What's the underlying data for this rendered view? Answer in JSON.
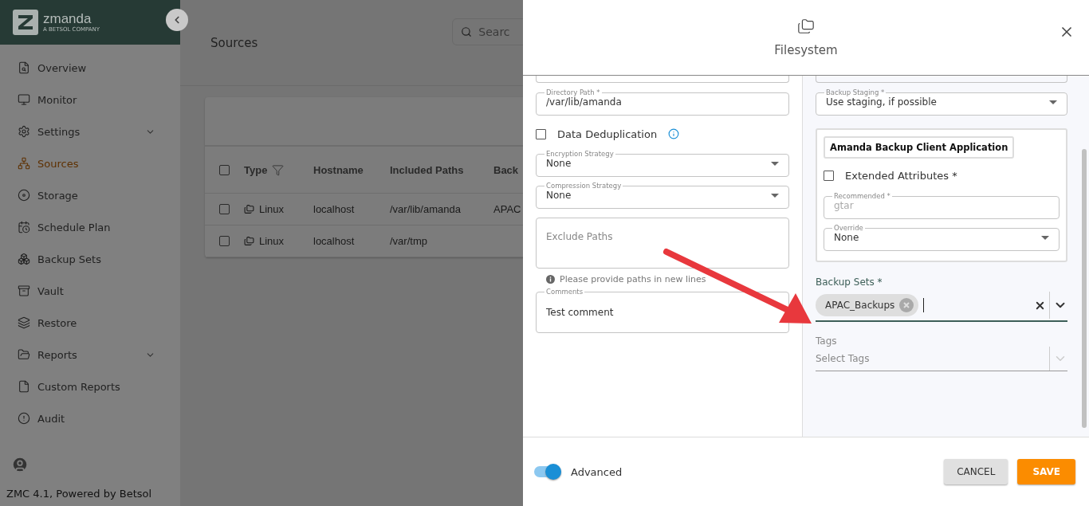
{
  "sidebar": {
    "logo": {
      "name": "zmanda",
      "tagline": "A BETSOL COMPANY"
    },
    "items": [
      {
        "label": "Overview",
        "selected": false,
        "expandable": false
      },
      {
        "label": "Monitor",
        "selected": false,
        "expandable": false
      },
      {
        "label": "Settings",
        "selected": false,
        "expandable": true
      },
      {
        "label": "Sources",
        "selected": true,
        "expandable": false
      },
      {
        "label": "Storage",
        "selected": false,
        "expandable": false
      },
      {
        "label": "Schedule Plan",
        "selected": false,
        "expandable": false
      },
      {
        "label": "Backup Sets",
        "selected": false,
        "expandable": false
      },
      {
        "label": "Vault",
        "selected": false,
        "expandable": false
      },
      {
        "label": "Restore",
        "selected": false,
        "expandable": false
      },
      {
        "label": "Reports",
        "selected": false,
        "expandable": true
      },
      {
        "label": "Custom Reports",
        "selected": false,
        "expandable": false
      },
      {
        "label": "Audit",
        "selected": false,
        "expandable": false
      }
    ],
    "footer": "ZMC 4.1, Powered by Betsol"
  },
  "page": {
    "title": "Sources",
    "search": {
      "placeholder": "Searc"
    },
    "table": {
      "all_checked": false,
      "columns": [
        "Type",
        "Hostname",
        "Included Paths",
        "Back"
      ],
      "rows": [
        {
          "checked": false,
          "type": "Linux",
          "hostname": "localhost",
          "paths": "/var/lib/amanda",
          "column_4": "APAC"
        },
        {
          "checked": false,
          "type": "Linux",
          "hostname": "localhost",
          "paths": "/var/tmp",
          "column_4": ""
        }
      ]
    }
  },
  "drawer": {
    "title": "Filesystem",
    "left": [
      {
        "kind": "input",
        "label": "Directory Path *",
        "value": "/var/lib/amanda"
      },
      {
        "kind": "checkbox",
        "label": "Data Deduplication",
        "checked": false
      },
      {
        "kind": "select",
        "label": "Encryption Strategy",
        "value": "None"
      },
      {
        "kind": "select",
        "label": "Compression Strategy",
        "value": "None"
      },
      {
        "kind": "textarea",
        "placeholder": "Exclude Paths"
      },
      {
        "kind": "hint",
        "text": "Please provide paths in new lines"
      },
      {
        "kind": "textarea",
        "label": "Comments",
        "value": "Test comment"
      }
    ],
    "right": [
      {
        "kind": "select",
        "label": "Backup Staging *",
        "value": "Use staging, if possible"
      },
      {
        "kind": "group",
        "title": "Amanda Backup Client Application",
        "children": [
          {
            "kind": "checkbox",
            "label": "Extended Attributes *",
            "checked": false
          },
          {
            "kind": "input",
            "label": "Recommended *",
            "value": "gtar",
            "disabled": true
          },
          {
            "kind": "select",
            "label": "Override",
            "value": "None"
          }
        ]
      },
      {
        "kind": "multiselect",
        "label": "Backup Sets *",
        "chips": [
          "APAC_Backups"
        ]
      },
      {
        "kind": "tagselect",
        "label": "Tags",
        "placeholder": "Select Tags"
      }
    ],
    "advanced": {
      "label": "Advanced",
      "on": true
    },
    "buttons": [
      {
        "label": "CANCEL",
        "kind": "secondary"
      },
      {
        "label": "SAVE",
        "kind": "primary"
      }
    ]
  }
}
